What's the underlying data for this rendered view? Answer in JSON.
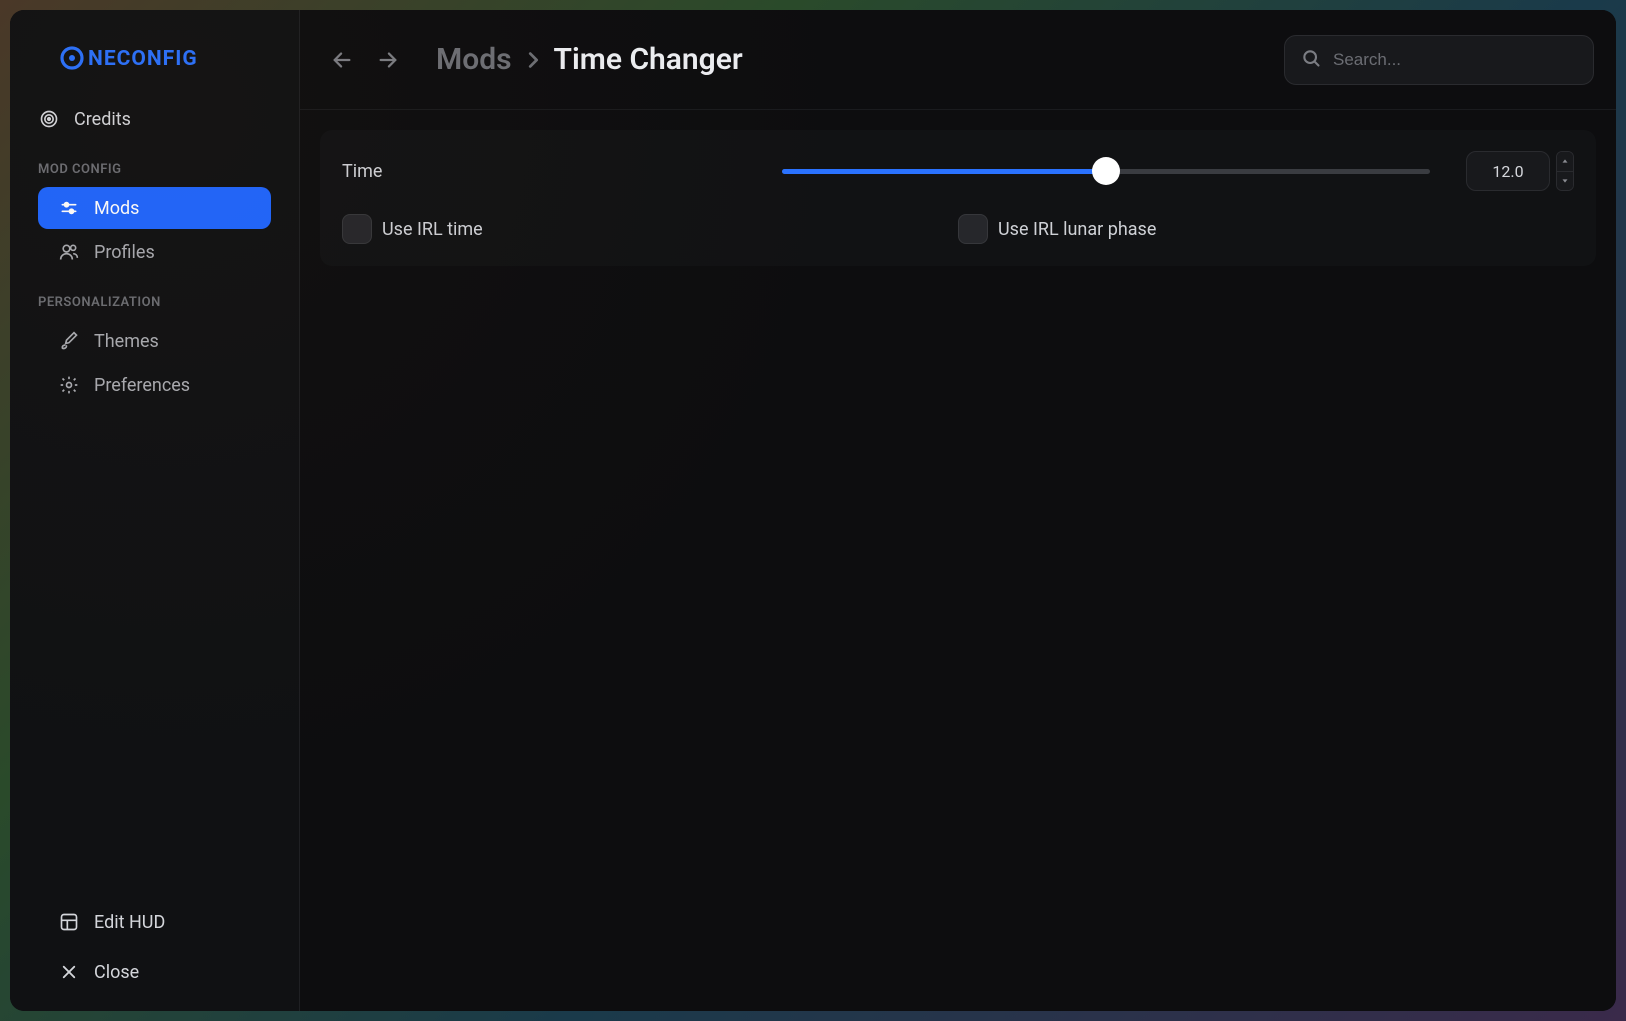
{
  "logo_text": "NECONFIG",
  "sidebar": {
    "credits_label": "Credits",
    "section_mod_config": "MOD CONFIG",
    "mods_label": "Mods",
    "profiles_label": "Profiles",
    "section_personalization": "PERSONALIZATION",
    "themes_label": "Themes",
    "preferences_label": "Preferences",
    "edit_hud_label": "Edit HUD",
    "close_label": "Close"
  },
  "header": {
    "breadcrumb_parent": "Mods",
    "breadcrumb_current": "Time Changer",
    "search_placeholder": "Search..."
  },
  "settings": {
    "time_label": "Time",
    "time_value": "12.0",
    "time_slider_percent": 50,
    "use_irl_time_label": "Use IRL time",
    "use_irl_time_checked": false,
    "use_irl_lunar_label": "Use IRL lunar phase",
    "use_irl_lunar_checked": false
  }
}
